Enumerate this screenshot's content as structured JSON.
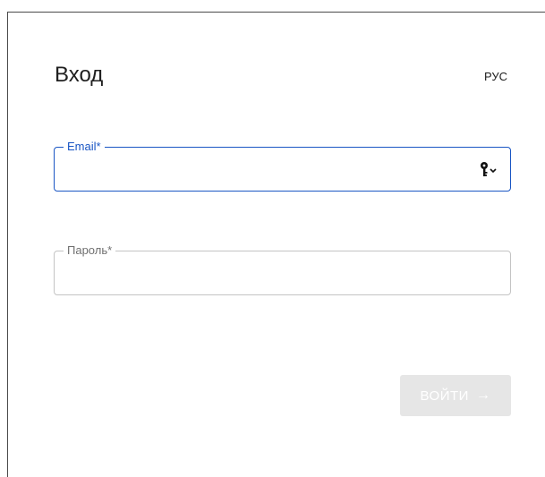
{
  "login": {
    "title": "Вход",
    "language": "РУС",
    "email": {
      "label": "Email*",
      "value": "",
      "icon": "key-icon"
    },
    "password": {
      "label": "Пароль*",
      "value": ""
    },
    "submit_label": "ВОЙТИ",
    "submit_icon": "arrow-right-icon"
  },
  "colors": {
    "accent": "#1a56c4",
    "border_inactive": "#c4c4c4",
    "button_disabled_bg": "#e6e6e6"
  }
}
